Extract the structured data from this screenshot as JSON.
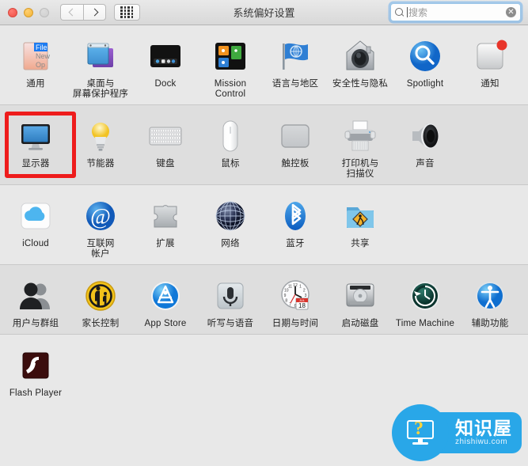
{
  "window": {
    "title": "系统偏好设置",
    "controls": {
      "close": "close-button",
      "minimize": "minimize-button",
      "zoom": "zoom-button"
    },
    "nav": {
      "back": "back-button",
      "forward": "forward-button",
      "grid": "show-all-button"
    }
  },
  "search": {
    "placeholder": "搜索",
    "value": "",
    "clear_label": "✕"
  },
  "highlight": {
    "target": "显示器",
    "color": "#ee1c1c"
  },
  "watermark": {
    "cn": "知识屋",
    "en": "zhishiwu.com",
    "color": "#29a7e8"
  },
  "rows": [
    {
      "shade": "light",
      "items": [
        {
          "label": "通用",
          "icon": "general-icon"
        },
        {
          "label": "桌面与\n屏幕保护程序",
          "icon": "desktop-screensaver-icon"
        },
        {
          "label": "Dock",
          "icon": "dock-icon"
        },
        {
          "label": "Mission\nControl",
          "icon": "mission-control-icon"
        },
        {
          "label": "语言与地区",
          "icon": "language-region-icon"
        },
        {
          "label": "安全性与隐私",
          "icon": "security-privacy-icon"
        },
        {
          "label": "Spotlight",
          "icon": "spotlight-icon"
        },
        {
          "label": "通知",
          "icon": "notifications-icon"
        }
      ]
    },
    {
      "shade": "dark",
      "items": [
        {
          "label": "显示器",
          "icon": "displays-icon"
        },
        {
          "label": "节能器",
          "icon": "energy-saver-icon"
        },
        {
          "label": "键盘",
          "icon": "keyboard-icon"
        },
        {
          "label": "鼠标",
          "icon": "mouse-icon"
        },
        {
          "label": "触控板",
          "icon": "trackpad-icon"
        },
        {
          "label": "打印机与\n扫描仪",
          "icon": "printers-scanners-icon"
        },
        {
          "label": "声音",
          "icon": "sound-icon"
        }
      ]
    },
    {
      "shade": "light",
      "items": [
        {
          "label": "iCloud",
          "icon": "icloud-icon"
        },
        {
          "label": "互联网\n帐户",
          "icon": "internet-accounts-icon"
        },
        {
          "label": "扩展",
          "icon": "extensions-icon"
        },
        {
          "label": "网络",
          "icon": "network-icon"
        },
        {
          "label": "蓝牙",
          "icon": "bluetooth-icon"
        },
        {
          "label": "共享",
          "icon": "sharing-icon"
        }
      ]
    },
    {
      "shade": "dark",
      "items": [
        {
          "label": "用户与群组",
          "icon": "users-groups-icon"
        },
        {
          "label": "家长控制",
          "icon": "parental-controls-icon"
        },
        {
          "label": "App Store",
          "icon": "app-store-icon"
        },
        {
          "label": "听写与语音",
          "icon": "dictation-speech-icon"
        },
        {
          "label": "日期与时间",
          "icon": "date-time-icon"
        },
        {
          "label": "启动磁盘",
          "icon": "startup-disk-icon"
        },
        {
          "label": "Time Machine",
          "icon": "time-machine-icon"
        },
        {
          "label": "辅助功能",
          "icon": "accessibility-icon"
        }
      ]
    },
    {
      "shade": "light",
      "items": [
        {
          "label": "Flash Player",
          "icon": "flash-player-icon"
        }
      ]
    }
  ]
}
